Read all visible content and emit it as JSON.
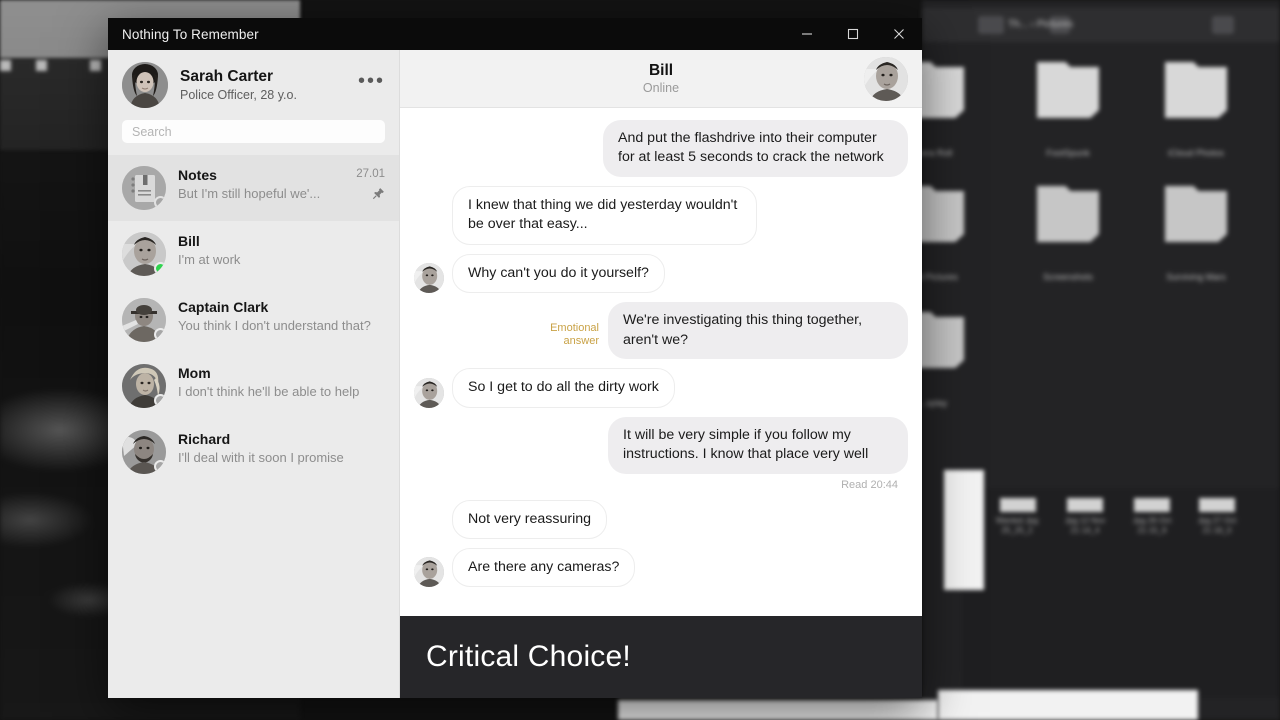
{
  "window": {
    "title": "Nothing To Remember",
    "controls": [
      {
        "name": "minimize",
        "glyph": "minimize-icon"
      },
      {
        "name": "maximize",
        "glyph": "maximize-icon"
      },
      {
        "name": "close",
        "glyph": "close-icon"
      }
    ]
  },
  "sidebar": {
    "profile": {
      "name": "Sarah Carter",
      "role": "Police Officer, 28 y.o.",
      "more_label": "•••"
    },
    "search": {
      "placeholder": "Search",
      "value": ""
    },
    "chats": [
      {
        "name": "Notes",
        "preview": "But I'm still hopeful we'...",
        "time": "27.01",
        "pinned": true,
        "active": true,
        "status": "offline",
        "avatar": "notes-icon"
      },
      {
        "name": "Bill",
        "preview": "I'm at work",
        "time": "",
        "pinned": false,
        "active": false,
        "status": "online",
        "avatar": "bill-photo"
      },
      {
        "name": "Captain Clark",
        "preview": "You think I don't understand that?",
        "time": "",
        "pinned": false,
        "active": false,
        "status": "offline",
        "avatar": "clark-photo"
      },
      {
        "name": "Mom",
        "preview": "I don't think he'll be able to help",
        "time": "",
        "pinned": false,
        "active": false,
        "status": "offline",
        "avatar": "mom-photo"
      },
      {
        "name": "Richard",
        "preview": "I'll deal with it soon I promise",
        "time": "",
        "pinned": false,
        "active": false,
        "status": "offline",
        "avatar": "richard-photo"
      }
    ]
  },
  "chat": {
    "title": "Bill",
    "status": "Online",
    "messages": [
      {
        "id": "m1",
        "side": "out",
        "text": "And put the flashdrive into their computer for at least 5 seconds to crack the network",
        "avatar": false,
        "tag": ""
      },
      {
        "id": "m2",
        "side": "in",
        "text": "I knew that thing we did yesterday wouldn't be over that easy...",
        "avatar": false,
        "tag": ""
      },
      {
        "id": "m3",
        "side": "in",
        "text": "Why can't you do it yourself?",
        "avatar": true,
        "tag": ""
      },
      {
        "id": "m4",
        "side": "out",
        "text": "We're investigating this thing together, aren't we?",
        "avatar": false,
        "tag": "Emotional answer"
      },
      {
        "id": "m5",
        "side": "in",
        "text": "So I get to do all the dirty work",
        "avatar": true,
        "tag": ""
      },
      {
        "id": "m6",
        "side": "out",
        "text": "It will be very simple if you follow my instructions. I know that place very well",
        "avatar": false,
        "tag": ""
      },
      {
        "id": "m7",
        "side": "in",
        "text": "Not very reassuring",
        "avatar": false,
        "tag": ""
      },
      {
        "id": "m8",
        "side": "in",
        "text": "Are there any cameras?",
        "avatar": true,
        "tag": ""
      }
    ],
    "read_receipt": "Read 20:44",
    "emotional_tag_line1": "Emotional",
    "emotional_tag_line2": "answer"
  },
  "banner": {
    "text": "Critical Choice!"
  },
  "colors": {
    "titlebar": "#0b0b0b",
    "sidebar": "#ebebeb",
    "active_row": "#e2e2e2",
    "chat_header": "#f2f2f2",
    "bubble_out": "#eeedef",
    "bubble_in": "#ffffff",
    "online": "#2fd44f",
    "offline": "#a6a6a6",
    "emotional_tag": "#c9a246",
    "banner_bg": "#262629",
    "banner_text": "#ffffff"
  },
  "background": {
    "explorer_breadcrumb": "Th... › Pictures",
    "folders": [
      "...era Roll",
      "FootSpunk",
      "iCloud Photos",
      "...al Pictures",
      "Screenshots",
      "Surviving Mars",
      "...splay"
    ]
  }
}
